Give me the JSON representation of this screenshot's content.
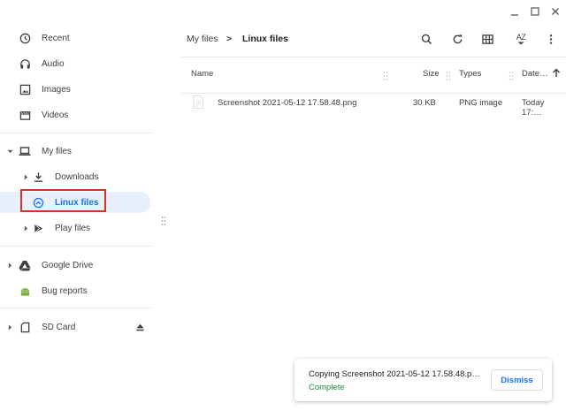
{
  "window": {
    "minimize_icon": "minimize-icon",
    "maximize_icon": "maximize-icon",
    "close_icon": "close-icon"
  },
  "sidebar": {
    "recent": "Recent",
    "audio": "Audio",
    "images": "Images",
    "videos": "Videos",
    "my_files": "My files",
    "downloads": "Downloads",
    "linux_files": "Linux files",
    "play_files": "Play files",
    "google_drive": "Google Drive",
    "bug_reports": "Bug reports",
    "sd_card": "SD Card"
  },
  "breadcrumb": {
    "parent": "My files",
    "separator": ">",
    "current": "Linux files"
  },
  "toolbar": {
    "sort_label": "AZ"
  },
  "table": {
    "headers": {
      "name": "Name",
      "size": "Size",
      "types": "Types",
      "date": "Date…"
    },
    "rows": [
      {
        "name": "Screenshot 2021-05-12 17.58.48.png",
        "size": "30 KB",
        "type": "PNG image",
        "date": "Today 17:…"
      }
    ]
  },
  "toast": {
    "message": "Copying Screenshot 2021-05-12 17.58.48.p…",
    "status": "Complete",
    "dismiss": "Dismiss"
  },
  "colors": {
    "accent": "#1a73e8",
    "selected_bg": "#e8f0fe",
    "highlight": "#d93025",
    "success": "#1e8e3e"
  }
}
